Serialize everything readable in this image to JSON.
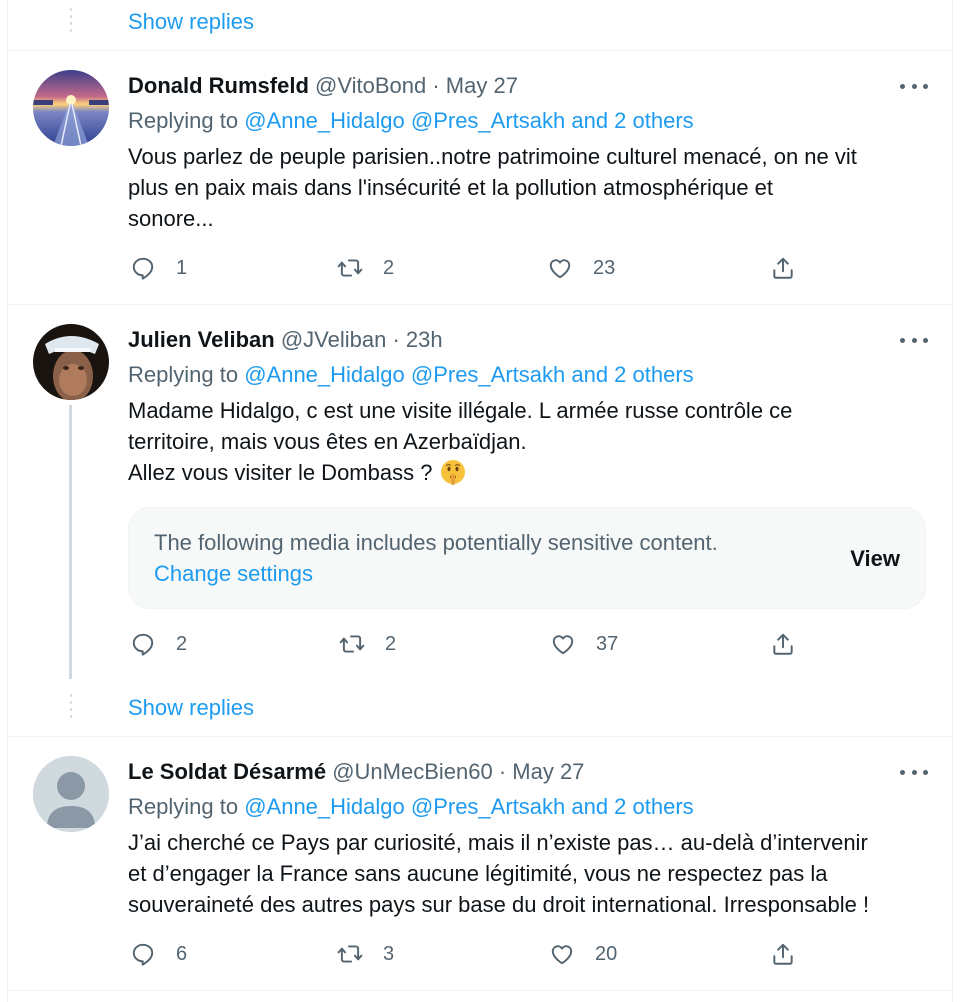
{
  "thread_controls": {
    "show_replies_label": "Show replies"
  },
  "tweets": [
    {
      "name": "Donald Rumsfeld",
      "meta": "@VitoBond · May 27",
      "replying_prefix": "Replying to",
      "replying_targets": "@Anne_Hidalgo @Pres_Artsakh and 2 others",
      "text_lines": [
        "Vous parlez de peuple parisien..notre patrimoine culturel menacé, on ne vit",
        "plus en paix mais dans l'insécurité et la pollution atmosphérique et",
        "sonore..."
      ],
      "counts": {
        "replies": "1",
        "retweets": "2",
        "likes": "23"
      }
    },
    {
      "name": "Julien Veliban",
      "meta": "@JVeliban · 23h",
      "replying_prefix": "Replying to",
      "replying_targets": "@Anne_Hidalgo @Pres_Artsakh and 2 others",
      "text_lines": [
        "Madame Hidalgo, c est une visite illégale. L armée russe contrôle ce",
        "territoire, mais vous êtes en Azerbaïdjan.",
        "Allez vous visiter le Dombass ?"
      ],
      "emoji": "shushing-face",
      "sensitive": {
        "message": "The following media includes potentially sensitive content.",
        "change_label": "Change settings",
        "view_label": "View"
      },
      "counts": {
        "replies": "2",
        "retweets": "2",
        "likes": "37"
      }
    },
    {
      "name": "Le Soldat Désarmé",
      "meta": "@UnMecBien60 · May 27",
      "replying_prefix": "Replying to",
      "replying_targets": "@Anne_Hidalgo @Pres_Artsakh and 2 others",
      "text_lines": [
        "J’ai cherché ce Pays par curiosité, mais il n’existe pas… au-delà d’intervenir",
        "et d’engager la France sans aucune légitimité, vous ne respectez pas la",
        "souveraineté des autres pays sur base du droit international. Irresponsable !"
      ],
      "counts": {
        "replies": "6",
        "retweets": "3",
        "likes": "20"
      }
    }
  ],
  "colors": {
    "accent": "#1d9bf0",
    "muted": "#536471",
    "text": "#0f1419",
    "border": "#eff3f4"
  },
  "icons": [
    "reply-icon",
    "retweet-icon",
    "like-icon",
    "share-icon",
    "more-icon",
    "shushing-face-emoji"
  ]
}
